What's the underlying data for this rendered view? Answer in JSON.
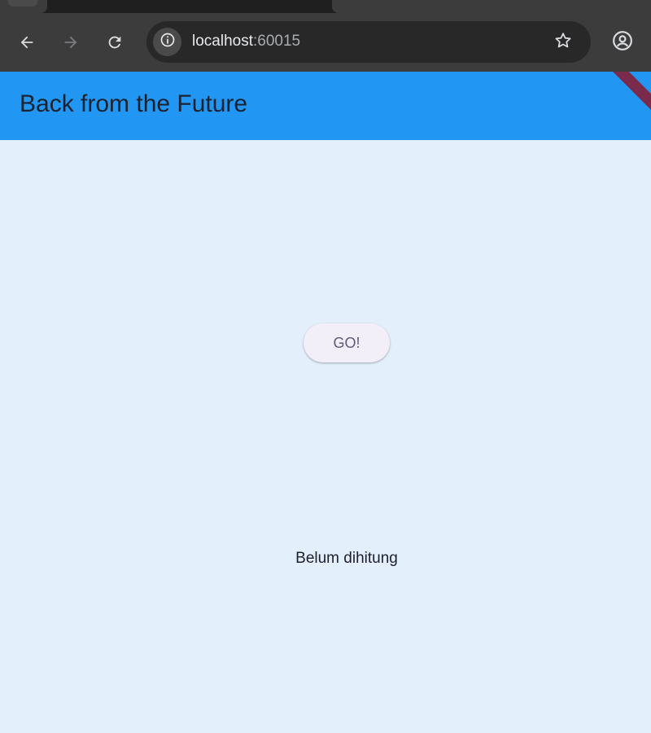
{
  "browser": {
    "url_host": "localhost",
    "url_port": ":60015",
    "icons": {
      "back": "arrow-left-icon",
      "forward": "arrow-right-icon",
      "reload": "reload-icon",
      "site_info": "info-icon",
      "bookmark": "star-icon",
      "profile": "account-circle-icon"
    }
  },
  "appbar": {
    "title": "Back from the Future",
    "color": "#2196f3"
  },
  "main": {
    "go_button_label": "GO!",
    "result_text": "Belum dihitung",
    "background": "#e3f0fc"
  }
}
